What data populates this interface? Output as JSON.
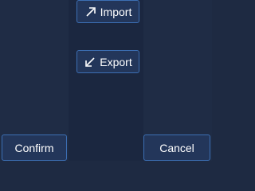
{
  "actions": {
    "import_label": "Import",
    "import_icon": "arrow-up-right-icon",
    "export_label": "Export",
    "export_icon": "arrow-down-left-icon"
  },
  "footer": {
    "confirm_label": "Confirm",
    "cancel_label": "Cancel"
  },
  "colors": {
    "background": "#1e2a42",
    "button_fill": "#23365a",
    "button_border": "#3c6fb4",
    "text": "#ffffff"
  }
}
